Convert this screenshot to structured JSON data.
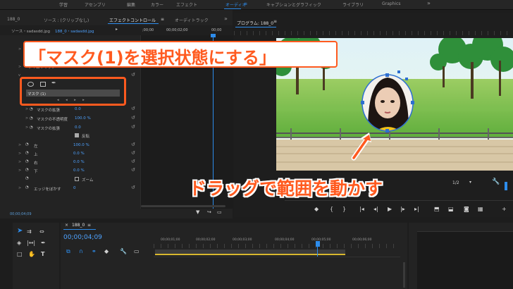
{
  "workspaces": [
    "学習",
    "アセンブリ",
    "編集",
    "カラー",
    "エフェクト",
    "オーディオ",
    "キャプションとグラフィック",
    "ライブラリ",
    "Graphics"
  ],
  "workspace_active": "オーディオ",
  "workspace_more": "»",
  "left_panel": {
    "sequence_tab": "188_0",
    "source_tab": "ソース : (クリップなし)",
    "effect_controls_tab": "エフェクトコントロール",
    "audio_track_tab": "オーディトラック",
    "source_clip": "ソース・sadasdd.jpg",
    "sequence_clip": "188_0・sadasdd.jpg",
    "timecodes": [
      ";00;00",
      "00;00;02;00",
      "00;00"
    ],
    "time_remap": "タイムリマップ",
    "mask_row": "マスク (1)",
    "rows": [
      {
        "label": "マスクの拡張",
        "value": "0.0"
      },
      {
        "label": "マスクの不透明度",
        "value": "100.0 %"
      },
      {
        "label": "マスクの拡張",
        "value": "0.0"
      }
    ],
    "inverted_label": "反転",
    "params": [
      {
        "label": "左",
        "value": "100.0 %"
      },
      {
        "label": "上",
        "value": "0.0 %"
      },
      {
        "label": "右",
        "value": "0.0 %"
      },
      {
        "label": "下",
        "value": "0.0 %"
      }
    ],
    "zoom_label": "ズーム",
    "feather_label": "エッジをぼかす",
    "feather_value": "0",
    "current_time": "00;00;04;09"
  },
  "program": {
    "title": "プログラム: 188_0",
    "resolution": "1/2",
    "wrench_icon": "wrench-icon"
  },
  "timeline": {
    "tab": "188_0",
    "timecode": "00;00;04;09",
    "ruler": [
      "00;00;01;00",
      "00;00;02;00",
      "00;00;03;00",
      "00;00;04;00",
      "00;00;05;00",
      "00;00;06;00"
    ]
  },
  "callouts": {
    "top": "「マスク(1)を選択状態にする」",
    "bottom": "ドラッグで範囲を動かす"
  },
  "colors": {
    "accent": "#2d8ceb",
    "callout": "#ff5a1f"
  }
}
